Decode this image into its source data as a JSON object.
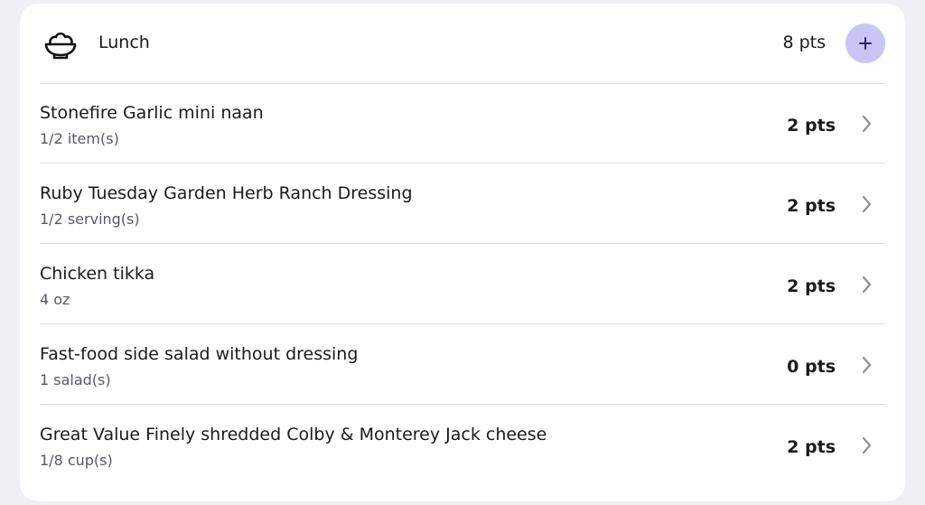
{
  "meal": {
    "icon": "salad-bowl-icon",
    "title": "Lunch",
    "points": "8 pts",
    "add_icon": "plus-icon"
  },
  "items": [
    {
      "name": "Stonefire Garlic mini naan",
      "quantity": "1/2 item(s)",
      "points": "2 pts"
    },
    {
      "name": "Ruby Tuesday Garden Herb Ranch Dressing",
      "quantity": "1/2 serving(s)",
      "points": "2 pts"
    },
    {
      "name": "Chicken tikka",
      "quantity": "4 oz",
      "points": "2 pts"
    },
    {
      "name": "Fast-food side salad without dressing",
      "quantity": "1 salad(s)",
      "points": "0 pts"
    },
    {
      "name": "Great Value Finely shredded Colby & Monterey Jack cheese",
      "quantity": "1/8 cup(s)",
      "points": "2 pts"
    }
  ],
  "colors": {
    "accent": "#c9c5f7",
    "accent_icon": "#2a2560",
    "divider": "#dcdcdc",
    "chevron": "#8a8f98"
  }
}
